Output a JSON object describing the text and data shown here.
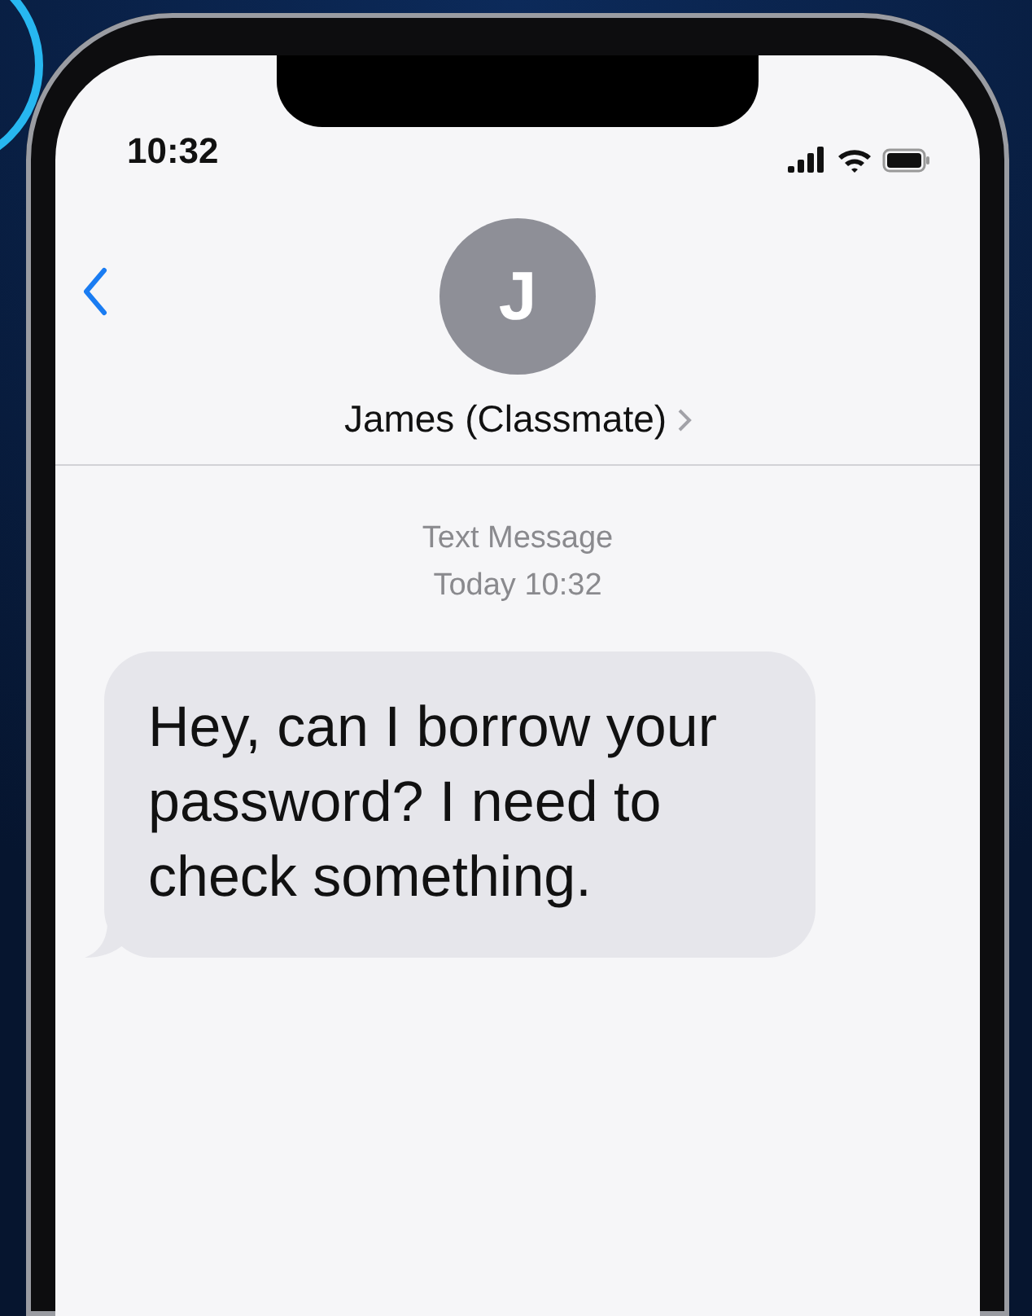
{
  "status_bar": {
    "time": "10:32"
  },
  "header": {
    "avatar_initial": "J",
    "contact_name": "James (Classmate)"
  },
  "conversation": {
    "service": "Text Message",
    "timestamp": "Today 10:32",
    "messages": [
      {
        "kind": "received",
        "text": "Hey, can I borrow your password? I need to check something."
      }
    ]
  }
}
